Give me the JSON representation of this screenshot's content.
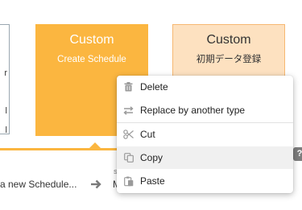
{
  "cards": [
    {
      "title": "Custom",
      "subtitle": "Create Schedule",
      "background": "#fbb640",
      "text_color": "#ffffff"
    },
    {
      "title": "Custom",
      "subtitle": "初期データ登録",
      "background": "#fde1c0",
      "border": "#f6b872",
      "text_color": "#333333"
    }
  ],
  "left_card_fragments": [
    "r",
    "l",
    "l"
  ],
  "steps": {
    "current_label": "a new Schedule...",
    "arrow_icon": "arrow-right-icon",
    "next_small_label": "S",
    "next_label_truncated": "M"
  },
  "help_badge": "?",
  "context_menu": {
    "items": [
      {
        "label": "Delete",
        "icon": "trash-icon"
      },
      {
        "label": "Replace by another type",
        "icon": "swap-arrows-icon"
      },
      {
        "label": "Cut",
        "icon": "scissors-icon"
      },
      {
        "label": "Copy",
        "icon": "copy-icon",
        "hovered": true
      },
      {
        "label": "Paste",
        "icon": "paste-icon"
      }
    ]
  },
  "colors": {
    "accent_orange": "#fbb640",
    "peach": "#fde1c0",
    "peach_border": "#f6b872",
    "menu_hover": "#f0f0f0"
  }
}
